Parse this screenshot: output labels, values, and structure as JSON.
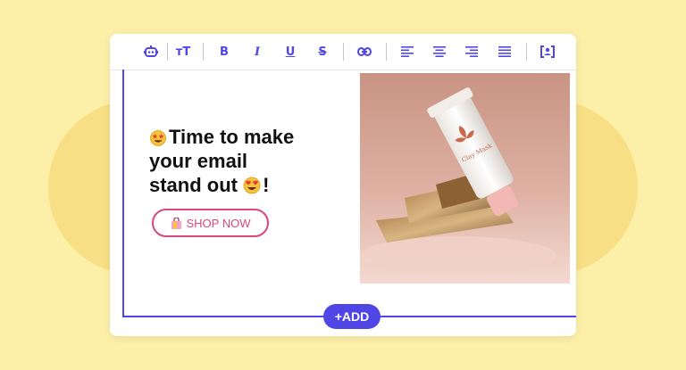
{
  "headline": {
    "line1": "Time to make",
    "line2": "your  email",
    "line3": "stand out ",
    "line3_end": "!"
  },
  "cta": {
    "label": "SHOP NOW"
  },
  "add_button": {
    "label": "+ADD"
  },
  "product": {
    "brand_text": "Clay Mask"
  },
  "toolbar": {
    "items": [
      "robot-icon",
      "text-size-icon",
      "bold-icon",
      "italic-icon",
      "underline-icon",
      "strikethrough-icon",
      "link-icon",
      "align-left-icon",
      "align-center-icon",
      "align-right-icon",
      "align-justify-icon",
      "personalize-icon"
    ],
    "bold_glyph": "B",
    "italic_glyph": "I",
    "underline_glyph": "U",
    "strike_glyph": "S",
    "textsize_glyph": "тT"
  },
  "colors": {
    "accent": "#4f46e5",
    "cta": "#d9487a",
    "background": "#fcefa8"
  }
}
